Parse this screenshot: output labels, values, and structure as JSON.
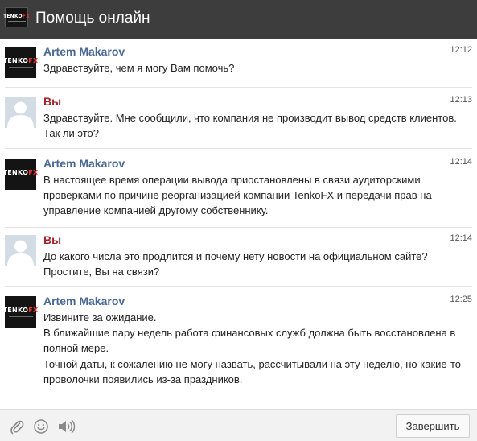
{
  "header": {
    "title": "Помощь онлайн",
    "logo_text": "TENKOFX"
  },
  "messages": [
    {
      "author": "Artem Makarov",
      "role": "operator",
      "time": "12:12",
      "lines": [
        "Здравствуйте, чем я могу Вам помочь?"
      ]
    },
    {
      "author": "Вы",
      "role": "user",
      "time": "12:13",
      "lines": [
        "Здравствуйте. Мне сообщили, что компания не производит вывод средств клиентов.",
        "Так ли это?"
      ]
    },
    {
      "author": "Artem Makarov",
      "role": "operator",
      "time": "12:14",
      "lines": [
        "В настоящее время операции вывода приостановлены в связи аудиторскими",
        "проверками по причине реорганизацией компании TenkoFX и передачи прав на",
        "управление компанией другому собственнику."
      ]
    },
    {
      "author": "Вы",
      "role": "user",
      "time": "12:14",
      "lines": [
        "До какого числа это продлится и почему нету новости на официальном сайте?",
        "Простите, Вы на связи?"
      ]
    },
    {
      "author": "Artem Makarov",
      "role": "operator",
      "time": "12:25",
      "lines": [
        "Извините за ожидание.",
        "В ближайшие пару недель работа финансовых служб должна быть восстановлена в",
        "полной мере.",
        "Точной даты, к сожалению не могу назвать, рассчитывали на эту неделю, но какие-то",
        "проволочки появились из-за праздников."
      ]
    }
  ],
  "footer": {
    "icons": [
      "paperclip-icon",
      "smiley-icon",
      "speaker-icon"
    ],
    "finish_label": "Завершить"
  },
  "colors": {
    "header_bg": "#3d3d3d",
    "operator_name": "#4a6894",
    "user_name": "#a1232b",
    "logo_accent": "#ee3333"
  }
}
